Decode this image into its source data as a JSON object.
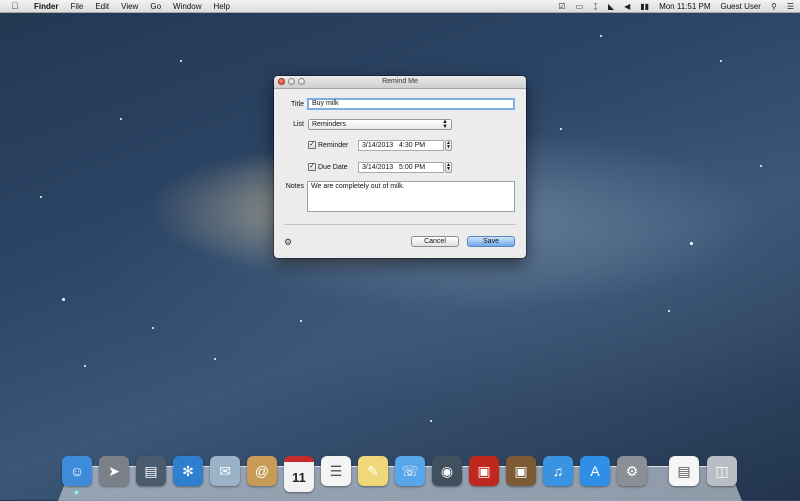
{
  "menubar": {
    "apple_icon": "apple-icon",
    "app_name": "Finder",
    "menus": [
      "File",
      "Edit",
      "View",
      "Go",
      "Window",
      "Help"
    ],
    "status_icons": [
      "checkbox-icon",
      "airplay-icon",
      "bluetooth-icon",
      "wifi-icon",
      "volume-icon",
      "battery-icon"
    ],
    "clock": "Mon 11:51 PM",
    "user": "Guest User",
    "spotlight_icon": "spotlight-icon",
    "notification_icon": "notification-center-icon"
  },
  "dialog": {
    "window_title": "Remind Me",
    "title_label": "Title",
    "title_value": "Buy milk",
    "list_label": "List",
    "list_value": "Reminders",
    "reminder_label": "Reminder",
    "reminder_checked": true,
    "reminder_date": "3/14/2013",
    "reminder_time": "4:30 PM",
    "due_label": "Due Date",
    "due_checked": true,
    "due_date": "3/14/2013",
    "due_time": "5:00 PM",
    "notes_label": "Notes",
    "notes_value": "We are completely out of milk.",
    "cancel_label": "Cancel",
    "save_label": "Save"
  },
  "dock": {
    "apps": [
      {
        "name": "Finder",
        "icon": "finder-icon",
        "color": "#3d8bd9"
      },
      {
        "name": "Launchpad",
        "icon": "launchpad-icon",
        "color": "#7a7f88"
      },
      {
        "name": "Mission Control",
        "icon": "mission-control-icon",
        "color": "#4a5b6e"
      },
      {
        "name": "Safari",
        "icon": "safari-icon",
        "color": "#2f7fd0"
      },
      {
        "name": "Mail",
        "icon": "mail-icon",
        "color": "#9bb3c9"
      },
      {
        "name": "Contacts",
        "icon": "contacts-icon",
        "color": "#c79a55"
      },
      {
        "name": "Calendar",
        "icon": "calendar-icon",
        "color": "#f2f2f2",
        "text": "11"
      },
      {
        "name": "Reminders",
        "icon": "reminders-icon",
        "color": "#f4f4f4"
      },
      {
        "name": "Notes",
        "icon": "notes-icon",
        "color": "#f0d77a"
      },
      {
        "name": "Messages",
        "icon": "messages-icon",
        "color": "#58a6ea"
      },
      {
        "name": "FaceTime",
        "icon": "facetime-icon",
        "color": "#40505f"
      },
      {
        "name": "Photo Booth",
        "icon": "photo-booth-icon",
        "color": "#c0281e"
      },
      {
        "name": "iPhoto",
        "icon": "iphoto-icon",
        "color": "#7b5a35"
      },
      {
        "name": "iTunes",
        "icon": "itunes-icon",
        "color": "#3a93e0"
      },
      {
        "name": "App Store",
        "icon": "app-store-icon",
        "color": "#2f8fe6"
      },
      {
        "name": "System Preferences",
        "icon": "system-preferences-icon",
        "color": "#8a8f96"
      },
      {
        "name": "Documents",
        "icon": "document-icon",
        "color": "#f6f6f6"
      },
      {
        "name": "Trash",
        "icon": "trash-icon",
        "color": "#b9bec4"
      }
    ]
  }
}
